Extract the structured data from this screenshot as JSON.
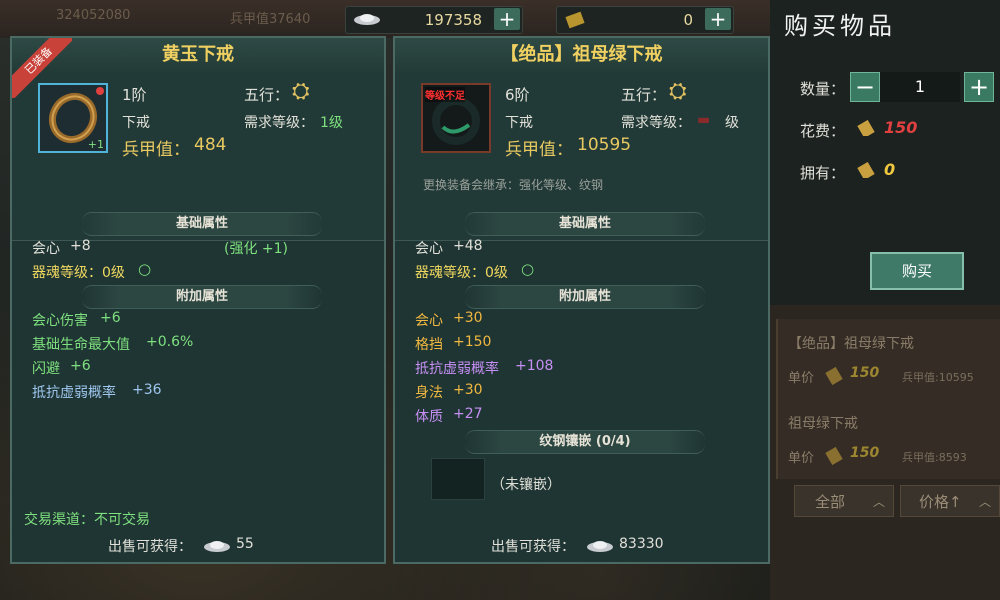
{
  "topbar": {
    "faint_left": "324052080",
    "faint_mid": "兵甲值37640",
    "silver": "197358",
    "gold": "0"
  },
  "left_item": {
    "equipped_badge": "已装备",
    "name": "黄玉下戒",
    "tier": "1阶",
    "element_label": "五行：",
    "type": "下戒",
    "req_label": "需求等级：",
    "req_value": "1级",
    "power_label": "兵甲值：",
    "power_value": "484",
    "icon_corner": "+1",
    "base_section": "基础属性",
    "base_stat_name": "会心",
    "base_stat_value": "+8",
    "enhance": "(强化 +1)",
    "soul_level": "器魂等级：0级",
    "extra_section": "附加属性",
    "extra": [
      {
        "name": "会心伤害",
        "value": "+6"
      },
      {
        "name": "基础生命最大值",
        "value": "+0.6%"
      },
      {
        "name": "闪避",
        "value": "+6"
      },
      {
        "name": "抵抗虚弱概率",
        "value": "+36"
      }
    ],
    "trade": "交易渠道：不可交易",
    "sell_label": "出售可获得：",
    "sell_value": "55"
  },
  "right_item": {
    "name": "【绝品】祖母绿下戒",
    "warn": "等级不足",
    "tier": "6阶",
    "element_label": "五行：",
    "type": "下戒",
    "req_label": "需求等级：",
    "req_value": "",
    "req_unit": "级",
    "power_label": "兵甲值：",
    "power_value": "10595",
    "inherit_note": "更换装备会继承：强化等级、纹钢",
    "base_section": "基础属性",
    "base_stat_name": "会心",
    "base_stat_value": "+48",
    "soul_level": "器魂等级：0级",
    "extra_section": "附加属性",
    "extra": [
      {
        "name": "会心",
        "value": "+30",
        "color": "orange"
      },
      {
        "name": "格挡",
        "value": "+150",
        "color": "orange"
      },
      {
        "name": "抵抗虚弱概率",
        "value": "+108",
        "color": "purple"
      },
      {
        "name": "身法",
        "value": "+30",
        "color": "orange"
      },
      {
        "name": "体质",
        "value": "+27",
        "color": "purple"
      }
    ],
    "socket_section": "纹钢镶嵌 (0/4)",
    "socket_empty": "（未镶嵌）",
    "sell_label": "出售可获得：",
    "sell_value": "83330"
  },
  "purchase": {
    "title": "购买物品",
    "qty_label": "数量：",
    "qty_value": "1",
    "cost_label": "花费：",
    "cost_value": "150",
    "own_label": "拥有：",
    "own_value": "0",
    "buy_label": "购买"
  },
  "market_list": [
    {
      "name": "【绝品】祖母绿下戒",
      "price_label": "单价",
      "price": "150",
      "power": "兵甲值:10595"
    },
    {
      "name": "祖母绿下戒",
      "price_label": "单价",
      "price": "150",
      "power": "兵甲值:8593"
    }
  ],
  "filters": {
    "all": "全部",
    "price": "价格↑"
  },
  "colors": {
    "accent": "#f0d060",
    "panel": "#1f3533",
    "button": "#3a7a62",
    "cost_red": "#e03030"
  }
}
